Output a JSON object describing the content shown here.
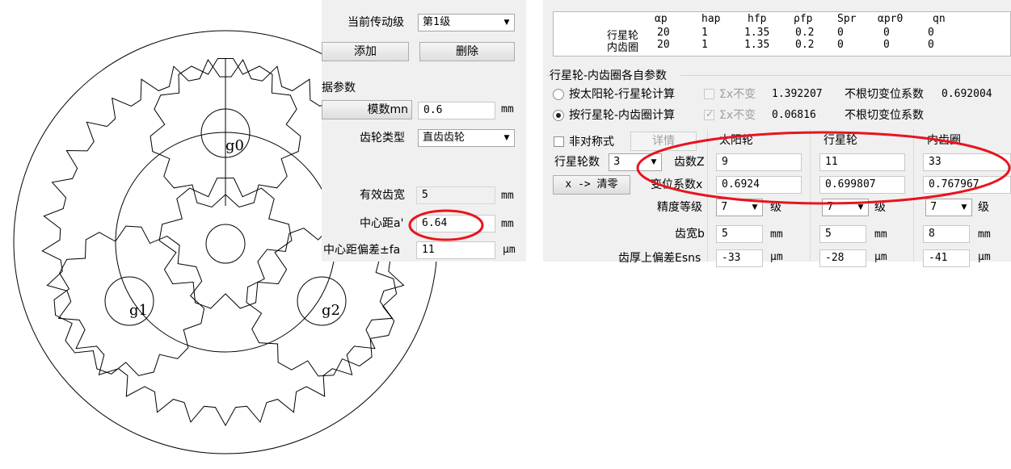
{
  "drawing": {
    "labels": {
      "g0": "g0",
      "g1": "g1",
      "g2": "g2"
    }
  },
  "left": {
    "stage_label": "当前传动级",
    "stage_value": "第1级",
    "add_button": "添加",
    "delete_button": "删除",
    "section_title": "据参数",
    "module_button": "模数mn",
    "module_value": "0.6",
    "module_unit": "mm",
    "gear_type_label": "齿轮类型",
    "gear_type_value": "直齿齿轮",
    "eff_width_label": "有效齿宽",
    "eff_width_value": "5",
    "eff_width_unit": "mm",
    "center_dist_label": "中心距a'",
    "center_dist_value": "6.64",
    "center_dist_unit": "mm",
    "center_dev_label": "中心距偏差±fa",
    "center_dev_value": "11",
    "center_dev_unit": "μm"
  },
  "table": {
    "headers": [
      "αp",
      "hap",
      "hfp",
      "ρfp",
      "Spr",
      "αpr0",
      "qn"
    ],
    "rows": [
      {
        "name": "行星轮",
        "values": [
          "20",
          "1",
          "1.35",
          "0.2",
          "0",
          "0",
          "0"
        ]
      },
      {
        "name": "内齿圈",
        "values": [
          "20",
          "1",
          "1.35",
          "0.2",
          "0",
          "0",
          "0"
        ]
      }
    ]
  },
  "right": {
    "section_title": "行星轮-内齿圈各自参数",
    "radio_sun_planet": "按太阳轮-行星轮计算",
    "radio_planet_ring": "按行星轮-内齿圈计算",
    "sum_x_label_1": "Σx不变",
    "sum_x_value_1": "1.392207",
    "sum_x_label_2": "Σx不变",
    "sum_x_value_2": "0.06816",
    "no_undercut_1": "不根切变位系数",
    "no_undercut_value_1": "0.692004",
    "no_undercut_2": "不根切变位系数",
    "asym_label": "非对称式",
    "detail_button": "详情",
    "planet_count_label": "行星轮数",
    "planet_count_value": "3",
    "clear_button": "x -> 清零",
    "columns": [
      "太阳轮",
      "行星轮",
      "内齿圈"
    ],
    "teeth_label": "齿数Z",
    "teeth": [
      "9",
      "11",
      "33"
    ],
    "shift_label": "变位系数x",
    "shift": [
      "0.6924",
      "0.699807",
      "0.767967"
    ],
    "precision_label": "精度等级",
    "precision": [
      "7",
      "7",
      "7"
    ],
    "precision_unit": "级",
    "width_label": "齿宽b",
    "width": [
      "5",
      "5",
      "8"
    ],
    "width_unit": "mm",
    "thickness_label": "齿厚上偏差Esns",
    "thickness": [
      "-33",
      "-28",
      "-41"
    ],
    "thickness_unit": "μm"
  }
}
